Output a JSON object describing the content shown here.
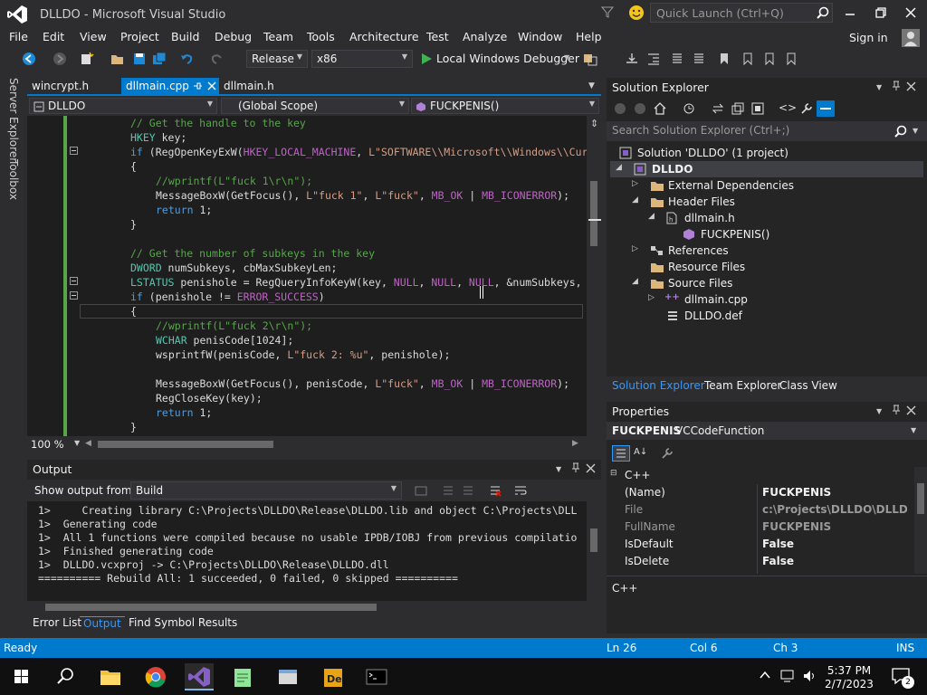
{
  "window": {
    "title": "DLLDO - Microsoft Visual Studio",
    "quick_launch_placeholder": "Quick Launch (Ctrl+Q)",
    "sign_in": "Sign in"
  },
  "menu": [
    "File",
    "Edit",
    "View",
    "Project",
    "Build",
    "Debug",
    "Team",
    "Tools",
    "Architecture",
    "Test",
    "Analyze",
    "Window",
    "Help"
  ],
  "toolbar": {
    "config": "Release",
    "platform": "x86",
    "run_label": "Local Windows Debugger"
  },
  "sidebar": {
    "server_explorer": "Server Explorer",
    "toolbox": "Toolbox"
  },
  "tabs": [
    {
      "label": "wincrypt.h"
    },
    {
      "label": "dllmain.cpp"
    },
    {
      "label": "dllmain.h"
    }
  ],
  "nav": {
    "project": "DLLDO",
    "scope": "(Global Scope)",
    "member": "FUCKPENIS()"
  },
  "code": [
    {
      "t": [
        [
          "cm",
          "// Get the handle to the key"
        ]
      ],
      "indent": 4
    },
    {
      "t": [
        [
          "ty",
          "HKEY"
        ],
        [
          "",
          " key;"
        ]
      ],
      "indent": 4
    },
    {
      "t": [
        [
          "kw",
          "if"
        ],
        [
          "",
          " (RegOpenKeyExW("
        ],
        [
          "mac",
          "HKEY_LOCAL_MACHINE"
        ],
        [
          "",
          ", "
        ],
        [
          "str",
          "L\"SOFTWARE\\\\Microsoft\\\\Windows\\\\Curren"
        ]
      ],
      "indent": 4
    },
    {
      "t": [
        [
          "",
          "{"
        ]
      ],
      "indent": 4
    },
    {
      "t": [
        [
          "cm",
          "//wprintf(L\"fuck 1\\r\\n\");"
        ]
      ],
      "indent": 8
    },
    {
      "t": [
        [
          "",
          "MessageBoxW(GetFocus(), "
        ],
        [
          "str",
          "L\"fuck 1\""
        ],
        [
          "",
          ", "
        ],
        [
          "str",
          "L\"fuck\""
        ],
        [
          "",
          ", "
        ],
        [
          "mac",
          "MB_OK"
        ],
        [
          "",
          " | "
        ],
        [
          "mac",
          "MB_ICONERROR"
        ],
        [
          "",
          ");"
        ]
      ],
      "indent": 8
    },
    {
      "t": [
        [
          "kw",
          "return"
        ],
        [
          "",
          " 1;"
        ]
      ],
      "indent": 8
    },
    {
      "t": [
        [
          "",
          "}"
        ]
      ],
      "indent": 4
    },
    {
      "t": [
        [
          "",
          ""
        ]
      ],
      "indent": 0
    },
    {
      "t": [
        [
          "cm",
          "// Get the number of subkeys in the key"
        ]
      ],
      "indent": 4
    },
    {
      "t": [
        [
          "ty",
          "DWORD"
        ],
        [
          "",
          " numSubkeys, cbMaxSubkeyLen;"
        ]
      ],
      "indent": 4
    },
    {
      "t": [
        [
          "ty",
          "LSTATUS"
        ],
        [
          "",
          " penishole = RegQueryInfoKeyW(key, "
        ],
        [
          "mac",
          "NULL"
        ],
        [
          "",
          ", "
        ],
        [
          "mac",
          "NULL"
        ],
        [
          "",
          ", "
        ],
        [
          "mac",
          "NULL"
        ],
        [
          "",
          ", &numSubkeys, &cb"
        ]
      ],
      "indent": 4
    },
    {
      "t": [
        [
          "kw",
          "if"
        ],
        [
          "",
          " (penishole != "
        ],
        [
          "mac",
          "ERROR_SUCCESS"
        ],
        [
          "",
          ")"
        ]
      ],
      "indent": 4
    },
    {
      "t": [
        [
          "",
          "{"
        ]
      ],
      "indent": 4
    },
    {
      "t": [
        [
          "cm",
          "//wprintf(L\"fuck 2\\r\\n\");"
        ]
      ],
      "indent": 8
    },
    {
      "t": [
        [
          "ty",
          "WCHAR"
        ],
        [
          "",
          " penisCode[1024];"
        ]
      ],
      "indent": 8
    },
    {
      "t": [
        [
          "",
          "wsprintfW(penisCode, "
        ],
        [
          "str",
          "L\"fuck 2: %u\""
        ],
        [
          "",
          ", penishole);"
        ]
      ],
      "indent": 8
    },
    {
      "t": [
        [
          "",
          ""
        ]
      ],
      "indent": 0
    },
    {
      "t": [
        [
          "",
          "MessageBoxW(GetFocus(), penisCode, "
        ],
        [
          "str",
          "L\"fuck\""
        ],
        [
          "",
          ", "
        ],
        [
          "mac",
          "MB_OK"
        ],
        [
          "",
          " | "
        ],
        [
          "mac",
          "MB_ICONERROR"
        ],
        [
          "",
          ");"
        ]
      ],
      "indent": 8
    },
    {
      "t": [
        [
          "",
          "RegCloseKey(key);"
        ]
      ],
      "indent": 8
    },
    {
      "t": [
        [
          "kw",
          "return"
        ],
        [
          "",
          " 1;"
        ]
      ],
      "indent": 8
    },
    {
      "t": [
        [
          "",
          "}"
        ]
      ],
      "indent": 4
    }
  ],
  "editor_status": {
    "zoom": "100 %"
  },
  "output": {
    "title": "Output",
    "show_from_label": "Show output from:",
    "source": "Build",
    "lines": [
      "1>     Creating library C:\\Projects\\DLLDO\\Release\\DLLDO.lib and object C:\\Projects\\DLL",
      "1>  Generating code",
      "1>  All 1 functions were compiled because no usable IPDB/IOBJ from previous compilatio",
      "1>  Finished generating code",
      "1>  DLLDO.vcxproj -> C:\\Projects\\DLLDO\\Release\\DLLDO.dll",
      "========== Rebuild All: 1 succeeded, 0 failed, 0 skipped =========="
    ]
  },
  "bottom_tabs": [
    "Error List",
    "Output",
    "Find Symbol Results"
  ],
  "solution_explorer": {
    "title": "Solution Explorer",
    "search_placeholder": "Search Solution Explorer (Ctrl+;)",
    "items": [
      {
        "label": "Solution 'DLLDO' (1 project)",
        "bold": false
      },
      {
        "label": "DLLDO",
        "bold": true
      },
      {
        "label": "External Dependencies",
        "bold": false
      },
      {
        "label": "Header Files",
        "bold": false
      },
      {
        "label": "dllmain.h",
        "bold": false
      },
      {
        "label": "FUCKPENIS()",
        "bold": false
      },
      {
        "label": "References",
        "bold": false
      },
      {
        "label": "Resource Files",
        "bold": false
      },
      {
        "label": "Source Files",
        "bold": false
      },
      {
        "label": "dllmain.cpp",
        "bold": false
      },
      {
        "label": "DLLDO.def",
        "bold": false
      }
    ],
    "tabs": [
      "Solution Explorer",
      "Team Explorer",
      "Class View"
    ]
  },
  "properties": {
    "title": "Properties",
    "object_name": "FUCKPENIS",
    "object_type": "VCCodeFunction",
    "category": "C++",
    "rows": [
      {
        "k": "(Name)",
        "v": "FUCKPENIS"
      },
      {
        "k": "File",
        "v": "c:\\Projects\\DLLDO\\DLLDO\\d"
      },
      {
        "k": "FullName",
        "v": "FUCKPENIS"
      },
      {
        "k": "IsDefault",
        "v": "False"
      },
      {
        "k": "IsDelete",
        "v": "False"
      }
    ],
    "description": "C++"
  },
  "status": {
    "ready": "Ready",
    "ln": "Ln 26",
    "col": "Col 6",
    "ch": "Ch 3",
    "mode": "INS"
  },
  "taskbar": {
    "time": "5:37 PM",
    "date": "2/7/2023",
    "notification_count": "2"
  },
  "colors": {
    "accent": "#007acc",
    "vs_purple": "#865fc5"
  }
}
